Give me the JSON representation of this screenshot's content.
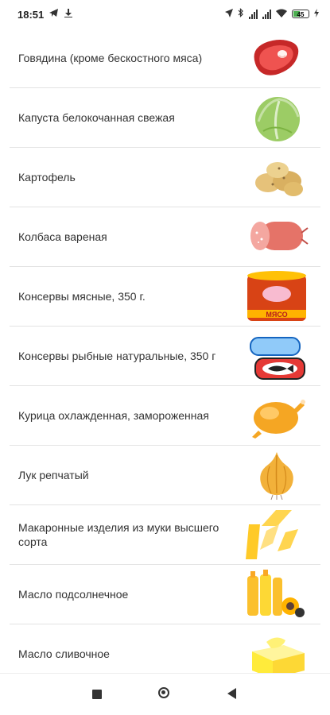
{
  "status_bar": {
    "time": "18:51",
    "battery": "45"
  },
  "products": [
    {
      "label": "Говядина (кроме бескостного мяса)",
      "icon": "beef-steak-icon"
    },
    {
      "label": "Капуста белокочанная свежая",
      "icon": "cabbage-icon"
    },
    {
      "label": "Картофель",
      "icon": "potatoes-icon"
    },
    {
      "label": "Колбаса вареная",
      "icon": "sausage-icon"
    },
    {
      "label": "Консервы мясные, 350 г.",
      "icon": "meat-can-icon",
      "can_label": "МЯСО"
    },
    {
      "label": "Консервы рыбные натуральные, 350 г",
      "icon": "fish-can-icon"
    },
    {
      "label": "Курица охлажденная, замороженная",
      "icon": "chicken-icon"
    },
    {
      "label": "Лук репчатый",
      "icon": "onion-icon"
    },
    {
      "label": "Макаронные изделия из муки высшего сорта",
      "icon": "pasta-icon"
    },
    {
      "label": "Масло подсолнечное",
      "icon": "sunflower-oil-icon"
    },
    {
      "label": "Масло сливочное",
      "icon": "butter-icon"
    }
  ]
}
